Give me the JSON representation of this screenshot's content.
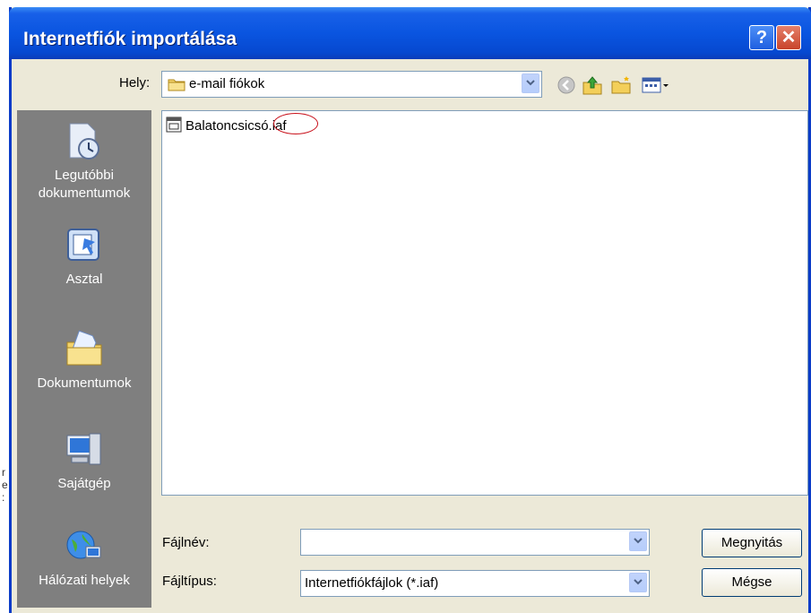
{
  "window": {
    "title": "Internetfiók importálása"
  },
  "title_buttons": {
    "help": "?",
    "close": "✕"
  },
  "location": {
    "label": "Hely:",
    "value": "e-mail fiókok"
  },
  "toolbar": {
    "icons": [
      "back-icon",
      "up-folder-icon",
      "new-folder-icon",
      "views-menu-icon"
    ]
  },
  "places": [
    {
      "label": "Legutóbbi\ndokumentumok",
      "icon": "recent-documents-icon"
    },
    {
      "label": "Asztal",
      "icon": "desktop-icon"
    },
    {
      "label": "Dokumentumok",
      "icon": "my-documents-icon"
    },
    {
      "label": "Sajátgép",
      "icon": "my-computer-icon"
    },
    {
      "label": "Hálózati helyek",
      "icon": "network-places-icon"
    }
  ],
  "files": [
    {
      "name": "Balatoncsicsó.iaf",
      "icon": "iaf-file-icon"
    }
  ],
  "filename": {
    "label": "Fájlnév:",
    "value": ""
  },
  "filetype": {
    "label": "Fájltípus:",
    "value": "Internetfiókfájlok (*.iaf)"
  },
  "buttons": {
    "open": "Megnyitás",
    "cancel": "Mégse"
  },
  "colors": {
    "title_bar": "#0a55e0",
    "places_bar": "#7f7f7f",
    "annotation": "#c8101a"
  }
}
